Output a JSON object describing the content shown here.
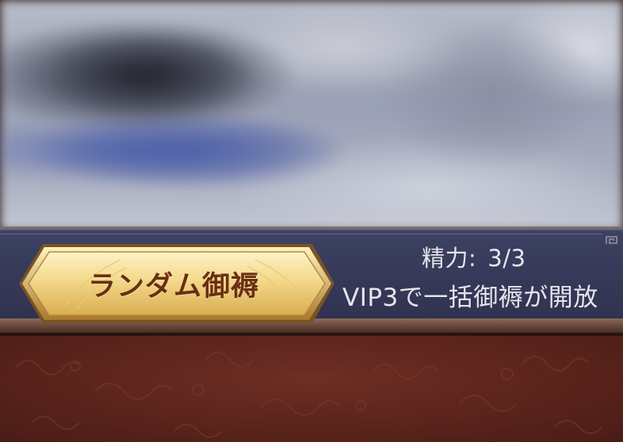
{
  "random_button": {
    "label": "ランダム御褥"
  },
  "stamina": {
    "label": "精力:",
    "value": "3/3"
  },
  "vip_notice": {
    "text": "VIP3で一括御褥が開放"
  },
  "colors": {
    "banner": "#353957",
    "gold_light": "#f7e7a6",
    "gold_dark": "#c79a3c",
    "button_text": "#6a2e12",
    "banner_text": "#e7e4ec",
    "panel_red": "#5b241c"
  }
}
